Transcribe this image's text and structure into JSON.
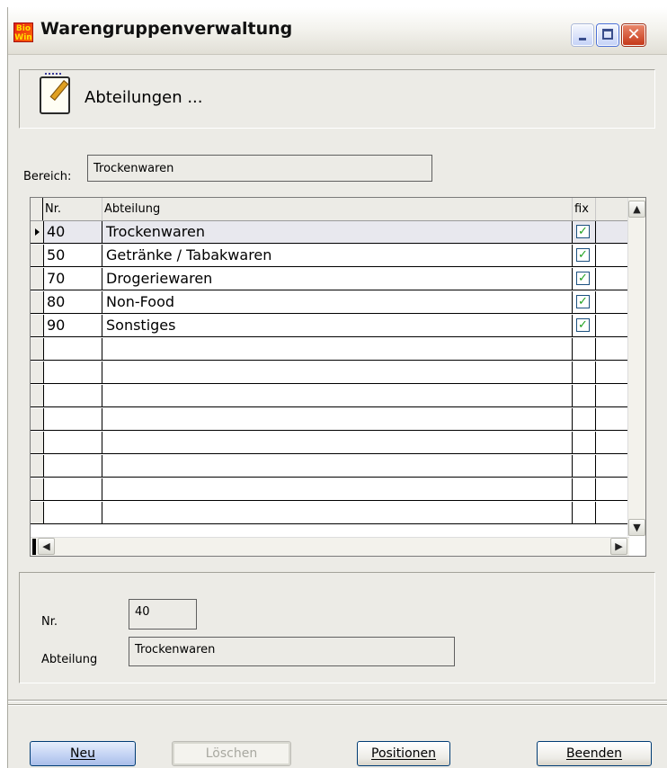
{
  "window": {
    "app_icon_text": "Bio Win",
    "title": "Warengruppenverwaltung",
    "controls": {
      "minimize": "_",
      "maximize": "□",
      "close": "X"
    }
  },
  "header": {
    "text": "Abteilungen ..."
  },
  "filter": {
    "label": "Bereich:",
    "value": "Trockenwaren"
  },
  "grid": {
    "columns": {
      "nr": "Nr.",
      "abteilung": "Abteilung",
      "fix": "fix"
    },
    "rows": [
      {
        "nr": "40",
        "abteilung": "Trockenwaren",
        "fix": true,
        "selected": true
      },
      {
        "nr": "50",
        "abteilung": "Getränke / Tabakwaren",
        "fix": true,
        "selected": false
      },
      {
        "nr": "70",
        "abteilung": "Drogeriewaren",
        "fix": true,
        "selected": false
      },
      {
        "nr": "80",
        "abteilung": "Non-Food",
        "fix": true,
        "selected": false
      },
      {
        "nr": "90",
        "abteilung": "Sonstiges",
        "fix": true,
        "selected": false
      }
    ],
    "empty_row_count": 8
  },
  "detail": {
    "nr_label": "Nr.",
    "nr_value": "40",
    "abteilung_label": "Abteilung",
    "abteilung_value": "Trockenwaren"
  },
  "buttons": {
    "neu": "Neu",
    "loeschen": "Löschen",
    "positionen": "Positionen",
    "beenden": "Beenden"
  }
}
